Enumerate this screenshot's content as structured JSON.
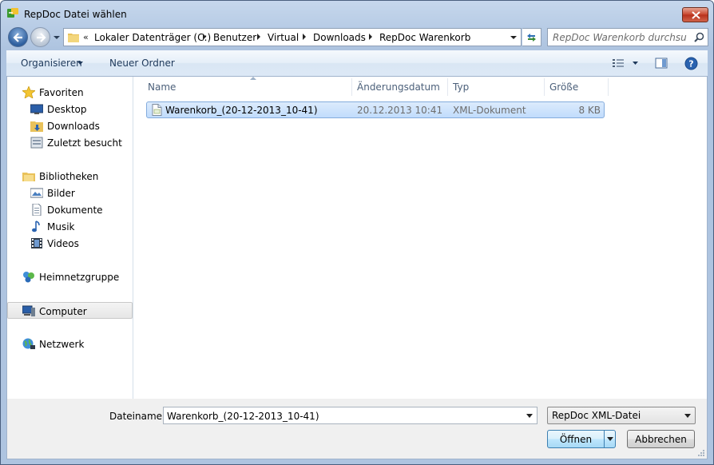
{
  "window": {
    "title": "RepDoc Datei wählen",
    "close_label": "×"
  },
  "address_bar": {
    "overflow_chevron": "«",
    "breadcrumbs": [
      "Lokaler Datenträger (C:)",
      "Benutzer",
      "Virtual",
      "Downloads",
      "RepDoc Warenkorb"
    ]
  },
  "search": {
    "placeholder": "RepDoc Warenkorb durchsuch..."
  },
  "toolbar": {
    "organize_label": "Organisieren",
    "new_folder_label": "Neuer Ordner"
  },
  "nav_pane": {
    "favorites": {
      "label": "Favoriten",
      "items": [
        "Desktop",
        "Downloads",
        "Zuletzt besucht"
      ]
    },
    "libraries": {
      "label": "Bibliotheken",
      "items": [
        "Bilder",
        "Dokumente",
        "Musik",
        "Videos"
      ]
    },
    "homegroup": "Heimnetzgruppe",
    "computer": "Computer",
    "network": "Netzwerk"
  },
  "file_list": {
    "columns": [
      "Name",
      "Änderungsdatum",
      "Typ",
      "Größe"
    ],
    "sort_column": "Name",
    "rows": [
      {
        "name": "Warenkorb_(20-12-2013_10-41)",
        "date": "20.12.2013 10:41",
        "type": "XML-Dokument",
        "size": "8 KB",
        "selected": true
      }
    ]
  },
  "bottom": {
    "filename_label": "Dateiname:",
    "filename_value": "Warenkorb_(20-12-2013_10-41)",
    "filter_value": "RepDoc XML-Datei",
    "open_label": "Öffnen",
    "cancel_label": "Abbrechen"
  },
  "colors": {
    "accent_blue": "#3c7fb1",
    "selection": "#c1dcfc",
    "close_red": "#c7432a"
  }
}
